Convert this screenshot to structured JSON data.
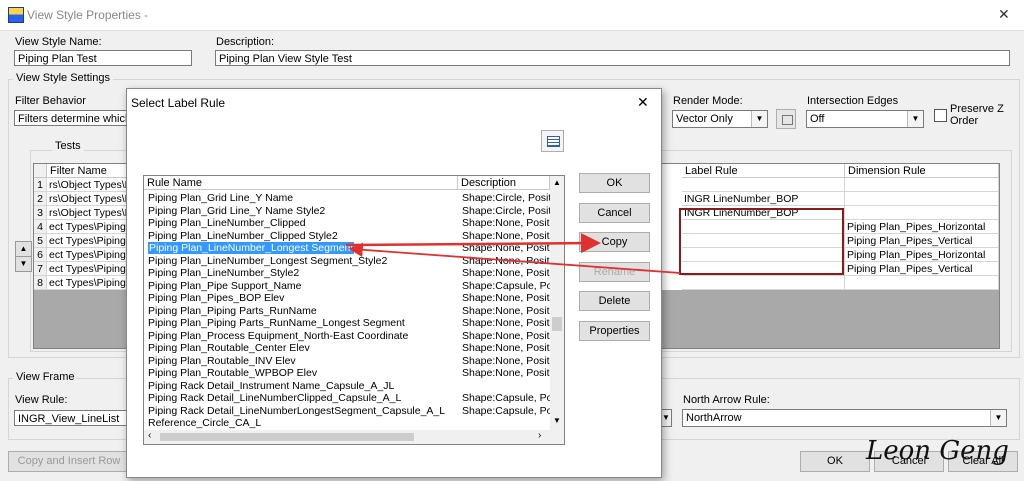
{
  "window": {
    "title": "View Style Properties -",
    "close_glyph": "✕"
  },
  "fields": {
    "view_style_name_label": "View Style Name:",
    "view_style_name_value": "Piping Plan Test",
    "description_label": "Description:",
    "description_value": "Piping Plan View Style Test"
  },
  "settings": {
    "group_title": "View Style Settings",
    "filter_behavior_label": "Filter Behavior",
    "filter_behavior_value": "Filters determine which ob",
    "render_mode_label": "Render Mode:",
    "render_mode_value": "Vector Only",
    "intersection_edges_label": "Intersection Edges",
    "intersection_edges_value": "Off",
    "preserve_z_order_label": "Preserve Z Order",
    "preserve_z_order_checked": false,
    "tests_title": "Tests"
  },
  "tests_grid": {
    "columns": [
      "Filter Name",
      "Label Rule",
      "Dimension Rule"
    ],
    "rows": [
      {
        "num": "1",
        "filter": "rs\\Object Types\\F",
        "label_rule": "",
        "dimension_rule": ""
      },
      {
        "num": "2",
        "filter": "rs\\Object Types\\F",
        "label_rule": "INGR LineNumber_BOP",
        "dimension_rule": ""
      },
      {
        "num": "3",
        "filter": "rs\\Object Types\\F",
        "label_rule": "INGR LineNumber_BOP",
        "dimension_rule": ""
      },
      {
        "num": "4",
        "filter": "ect Types\\Piping\\",
        "label_rule": "",
        "dimension_rule": "Piping Plan_Pipes_Horizontal"
      },
      {
        "num": "5",
        "filter": "ect Types\\Piping\\",
        "label_rule": "",
        "dimension_rule": "Piping Plan_Pipes_Vertical"
      },
      {
        "num": "6",
        "filter": "ect Types\\Piping\\",
        "label_rule": "",
        "dimension_rule": "Piping Plan_Pipes_Horizontal"
      },
      {
        "num": "7",
        "filter": "ect Types\\Piping\\",
        "label_rule": "",
        "dimension_rule": "Piping Plan_Pipes_Vertical"
      },
      {
        "num": "8",
        "filter": "ect Types\\Piping\\",
        "label_rule": "",
        "dimension_rule": ""
      }
    ]
  },
  "view_frame": {
    "title": "View Frame",
    "view_rule_label": "View Rule:",
    "view_rule_value": "INGR_View_LineList",
    "north_arrow_label": "North Arrow Rule:",
    "north_arrow_value": "NorthArrow"
  },
  "bottom_buttons": {
    "copy_insert_row": "Copy and Insert Row",
    "ok": "OK",
    "cancel": "Cancel",
    "clear_all": "Clear All"
  },
  "dialog": {
    "title": "Select Label Rule",
    "close_glyph": "✕",
    "columns": [
      "Rule Name",
      "Description"
    ],
    "rows": [
      {
        "name": "Piping Plan_Grid Line_Y Name",
        "desc": "Shape:Circle, Positi"
      },
      {
        "name": "Piping Plan_Grid Line_Y Name Style2",
        "desc": "Shape:Circle, Positi"
      },
      {
        "name": "Piping Plan_LineNumber_Clipped",
        "desc": "Shape:None, Positi"
      },
      {
        "name": "Piping Plan_LineNumber_Clipped Style2",
        "desc": "Shape:None, Positi"
      },
      {
        "name": "Piping Plan_LineNumber_Longest Segment",
        "desc": "Shape:None, Positi",
        "selected": true
      },
      {
        "name": "Piping Plan_LineNumber_Longest Segment_Style2",
        "desc": "Shape:None, Positi"
      },
      {
        "name": "Piping Plan_LineNumber_Style2",
        "desc": "Shape:None, Positi"
      },
      {
        "name": "Piping Plan_Pipe Support_Name",
        "desc": "Shape:Capsule, Po"
      },
      {
        "name": "Piping Plan_Pipes_BOP Elev",
        "desc": "Shape:None, Positi"
      },
      {
        "name": "Piping Plan_Piping Parts_RunName",
        "desc": "Shape:None, Positi"
      },
      {
        "name": "Piping Plan_Piping Parts_RunName_Longest Segment",
        "desc": "Shape:None, Positi"
      },
      {
        "name": "Piping Plan_Process Equipment_North-East Coordinate",
        "desc": "Shape:None, Positi"
      },
      {
        "name": "Piping Plan_Routable_Center Elev",
        "desc": "Shape:None, Positi"
      },
      {
        "name": "Piping Plan_Routable_INV Elev",
        "desc": "Shape:None, Positi"
      },
      {
        "name": "Piping Plan_Routable_WPBOP Elev",
        "desc": "Shape:None, Positi"
      },
      {
        "name": "Piping Rack Detail_Instrument Name_Capsule_A_JL",
        "desc": ""
      },
      {
        "name": "Piping Rack Detail_LineNumberClipped_Capsule_A_L",
        "desc": "Shape:Capsule, Po"
      },
      {
        "name": "Piping Rack Detail_LineNumberLongestSegment_Capsule_A_L",
        "desc": "Shape:Capsule, Po"
      },
      {
        "name": "Reference_Circle_CA_L",
        "desc": ""
      }
    ],
    "buttons": [
      "OK",
      "Cancel",
      "Copy",
      "Rename",
      "Delete",
      "Properties"
    ]
  },
  "watermark": "Leon Geng",
  "colors": {
    "selection": "#3399ff",
    "arrow": "#e03030",
    "highlight_box": "#8b1a1a"
  }
}
